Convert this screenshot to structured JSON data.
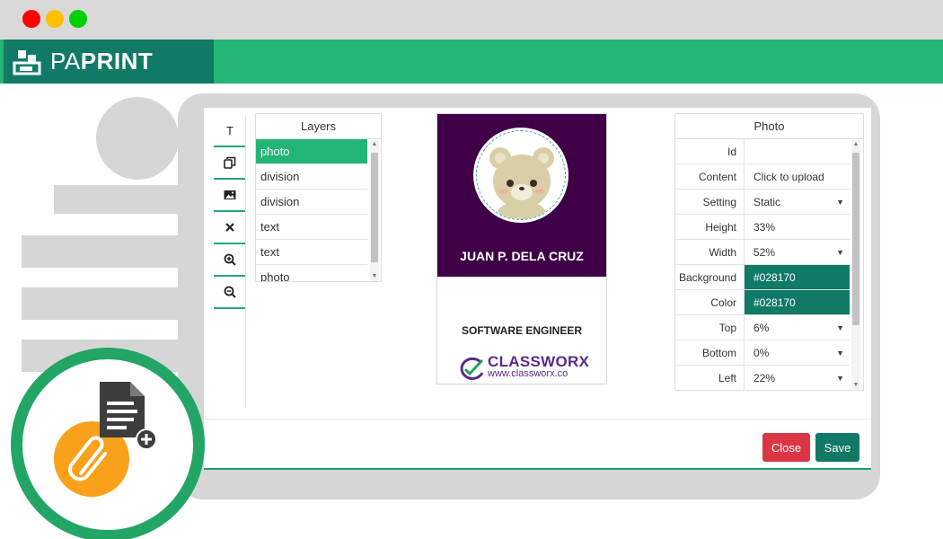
{
  "app": {
    "brand_light": "PA",
    "brand_bold": "PRINT"
  },
  "colors": {
    "brand_green": "#23b574",
    "brand_dark": "#117a67",
    "card_purple": "#3f0048",
    "close_red": "#dc3545"
  },
  "tools": [
    {
      "icon": "text-tool-icon",
      "label": "T"
    },
    {
      "icon": "copy-icon"
    },
    {
      "icon": "image-icon"
    },
    {
      "icon": "delete-icon"
    },
    {
      "icon": "zoom-in-icon"
    },
    {
      "icon": "zoom-out-icon"
    }
  ],
  "layers": {
    "title": "Layers",
    "items": [
      {
        "label": "photo",
        "selected": true
      },
      {
        "label": "division"
      },
      {
        "label": "division"
      },
      {
        "label": "text"
      },
      {
        "label": "text"
      },
      {
        "label": "photo"
      }
    ]
  },
  "card": {
    "name": "JUAN P. DELA CRUZ",
    "title": "SOFTWARE ENGINEER",
    "logo_name": "CLASSWORX",
    "logo_url": "www.classworx.co"
  },
  "properties": {
    "title": "Photo",
    "rows": [
      {
        "label": "Id",
        "value": ""
      },
      {
        "label": "Content",
        "value": "Click to upload"
      },
      {
        "label": "Setting",
        "value": "Static",
        "dropdown": true
      },
      {
        "label": "Height",
        "value": "33%"
      },
      {
        "label": "Width",
        "value": "52%",
        "dropdown": true
      },
      {
        "label": "Background",
        "value": "#028170",
        "filled": true
      },
      {
        "label": "Color",
        "value": "#028170",
        "filled": true
      },
      {
        "label": "Top",
        "value": "6%",
        "dropdown": true
      },
      {
        "label": "Bottom",
        "value": "0%",
        "dropdown": true
      },
      {
        "label": "Left",
        "value": "22%",
        "dropdown": true
      }
    ]
  },
  "buttons": {
    "close": "Close",
    "save": "Save"
  }
}
